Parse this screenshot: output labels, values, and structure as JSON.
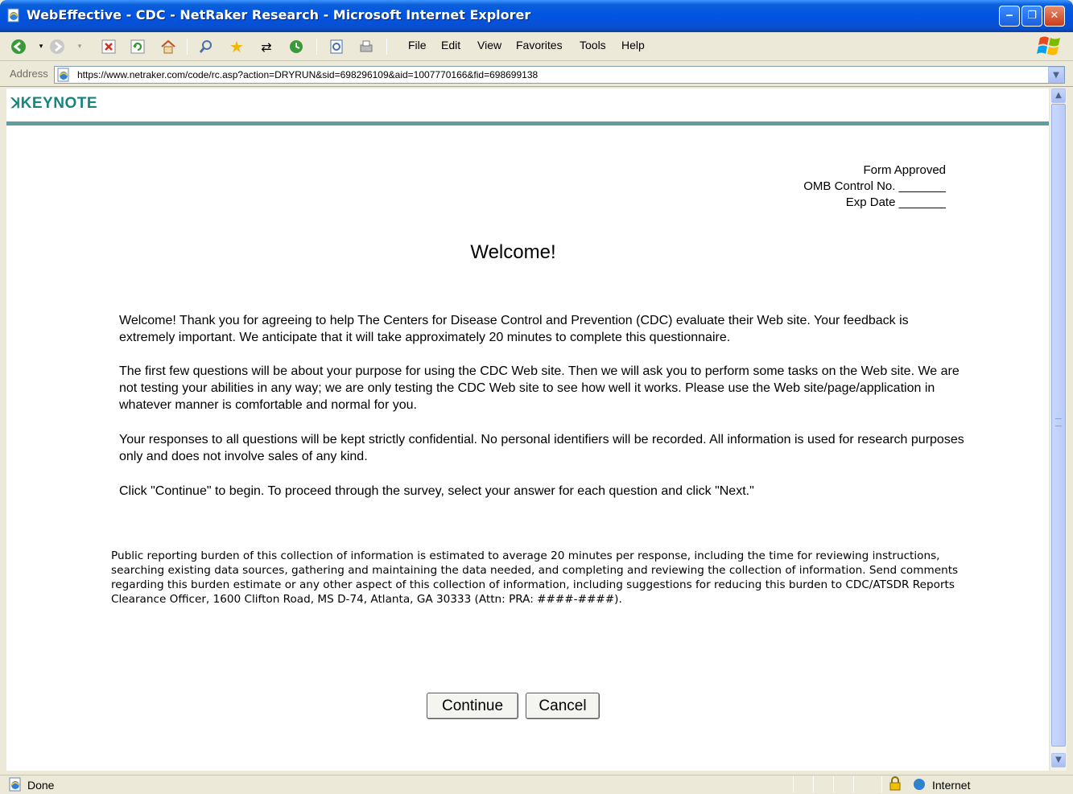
{
  "window": {
    "title": "WebEffective - CDC - NetRaker Research - Microsoft Internet Explorer",
    "minimize_label": "‒",
    "maximize_label": "❐",
    "close_label": "✕"
  },
  "menu": {
    "items": [
      "File",
      "Edit",
      "View",
      "Favorites",
      "Tools",
      "Help"
    ]
  },
  "address": {
    "label": "Address",
    "url": "https://www.netraker.com/code/rc.asp?action=DRYRUN&sid=698296109&aid=1007770166&fid=698699138"
  },
  "page": {
    "brand": "KEYNOTE",
    "form_approved": {
      "line1": "Form Approved",
      "line2": "OMB Control No. _______",
      "line3": "Exp Date _______"
    },
    "title": "Welcome!",
    "paragraphs": [
      "Welcome! Thank you for agreeing to help The Centers for Disease Control and Prevention (CDC) evaluate their Web site. Your feedback is extremely important. We anticipate that it will take approximately 20 minutes to complete this questionnaire.",
      "The first few questions will be about your purpose for using the CDC Web site. Then we will ask you to perform some tasks on the Web site. We are not testing your abilities in any way; we are only testing the CDC Web site to see how well it works. Please use the Web site/page/application in whatever manner is comfortable and normal for you.",
      "Your responses to all questions will be kept strictly confidential. No personal identifiers will be recorded. All information is used for research purposes only and does not involve sales of any kind.",
      "Click \"Continue\" to begin. To proceed through the survey, select your answer for each question and click \"Next.\""
    ],
    "burden_text": "Public reporting burden of this collection of information is estimated to average 20 minutes per response, including the time for reviewing instructions, searching existing data sources, gathering and maintaining the data needed, and completing and reviewing the collection of information. Send comments regarding this burden estimate or any other aspect of this collection of information, including suggestions for reducing this burden to CDC/ATSDR Reports Clearance Officer, 1600 Clifton Road, MS D-74, Atlanta, GA 30333 (Attn: PRA: ####-####).",
    "continue_label": "Continue",
    "cancel_label": "Cancel"
  },
  "status": {
    "text": "Done",
    "zone": "Internet"
  },
  "colors": {
    "titlebar": "#0054e3",
    "brand": "#17847e",
    "rule": "#5f9ea0"
  }
}
